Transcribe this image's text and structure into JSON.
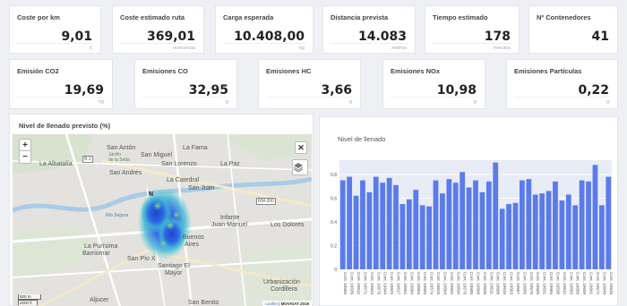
{
  "kpis_row1": [
    {
      "label": "Coste por km",
      "value": "9,01",
      "unit": "€"
    },
    {
      "label": "Coste estimado ruta",
      "value": "369,01",
      "unit": "euros/ruta"
    },
    {
      "label": "Carga esperada",
      "value": "10.408,00",
      "unit": "kg"
    },
    {
      "label": "Distancia prevista",
      "value": "14.083",
      "unit": "metros"
    },
    {
      "label": "Tiempo estimado",
      "value": "178",
      "unit": "minutos"
    },
    {
      "label": "Nº Contenedores",
      "value": "41",
      "unit": ""
    }
  ],
  "kpis_row2": [
    {
      "label": "Emisión CO2",
      "value": "19,69",
      "unit": "kg"
    },
    {
      "label": "Emisiones CO",
      "value": "32,95",
      "unit": "g"
    },
    {
      "label": "Emisiones HC",
      "value": "3,66",
      "unit": "g"
    },
    {
      "label": "Emisiones NOx",
      "value": "10,98",
      "unit": "g"
    },
    {
      "label": "Emisiones Partículas",
      "value": "0,22",
      "unit": "g"
    }
  ],
  "map_panel": {
    "title": "Nivel de llenado previsto (%)",
    "zoom_in": "+",
    "zoom_out": "−",
    "fullscreen": "✕",
    "attribution_link": "Leaflet",
    "attribution_sep": " | ",
    "attribution_brand": "MOVISAT 2019",
    "scale_m": "500 m",
    "scale_ft": "2000 ft",
    "labels": {
      "san_anton": "San Antón",
      "la_fama": "La Fama",
      "san_miguel": "San Miguel",
      "la_albatalia": "La Albatalía",
      "san_lorenzo": "San Lorenzo",
      "la_paz": "La Paz",
      "san_andres": "San Andrés",
      "la_catedral": "La Catedral",
      "san_juan": "San Juan",
      "infante": "Infante",
      "juan_manuel": "Juan Manuel",
      "los_dolores": "Los Dolores",
      "buenos": "Buenos",
      "aires": "Aires",
      "la_purisima": "La Purísima",
      "barriomar": "Barriomar",
      "san_pio": "San Pío X",
      "santiago": "Santiago El",
      "mayor": "Mayor",
      "urbanizacion": "Urbanización",
      "cordillera": "Cordillera",
      "aljucer": "Aljucer",
      "san_benito": "San Benito",
      "jardin": "Jardín",
      "de_la_seda": "de la Seda",
      "rio": "Río Segura",
      "rm300": "RM-300",
      "b1": "B-1",
      "n": "N"
    }
  },
  "chart_panel": {
    "title": "Nivel de llenado"
  },
  "colors": {
    "bar": "#5b7bea",
    "plot_bg": "#e8ecf6",
    "heat_core": "#2a5fe0",
    "heat_edge": "#3fd2c8"
  },
  "chart_data": {
    "type": "bar",
    "title": "Nivel de llenado",
    "ylim": [
      0,
      0.92
    ],
    "yticks": [
      0,
      0.2,
      0.4,
      0.6,
      0.8
    ],
    "ytick_labels": [
      "0",
      "0.2",
      "0.4",
      "0.6",
      "0.8"
    ],
    "categories": [
      "Cont. 19560",
      "Cont. 19636",
      "Cont. 19812",
      "Cont. 19571",
      "Cont. 19643",
      "Cont. 19579",
      "Cont. 19644",
      "Cont. 19625",
      "Cont. 19617",
      "Cont. 19552",
      "Cont. 19584",
      "Cont. 19603",
      "Cont. 19593",
      "Cont. 19574",
      "Cont. 19626",
      "Cont. 19564",
      "Cont. 19592",
      "Cont. 19634",
      "Cont. 19578",
      "Cont. 19585",
      "Cont. 19606",
      "Cont. 19636",
      "Cont. 19611",
      "Cont. 19600",
      "Cont. 19610",
      "Cont. 19563",
      "Cont. 19567",
      "Cont. 19605",
      "Cont. 19575",
      "Cont. 19588",
      "Cont. 19631",
      "Cont. 19565",
      "Cont. 19598",
      "Cont. 19612",
      "Cont. 19583",
      "Cont. 19650",
      "Cont. 19609",
      "Cont. 19601",
      "Cont. 19572",
      "Cont. 19648",
      "Cont. 19646"
    ],
    "values": [
      0.75,
      0.78,
      0.62,
      0.75,
      0.65,
      0.78,
      0.73,
      0.77,
      0.71,
      0.55,
      0.59,
      0.67,
      0.54,
      0.53,
      0.75,
      0.64,
      0.76,
      0.73,
      0.82,
      0.69,
      0.75,
      0.65,
      0.74,
      0.9,
      0.51,
      0.55,
      0.56,
      0.75,
      0.76,
      0.63,
      0.64,
      0.66,
      0.74,
      0.58,
      0.63,
      0.54,
      0.75,
      0.74,
      0.88,
      0.54,
      0.78
    ]
  }
}
